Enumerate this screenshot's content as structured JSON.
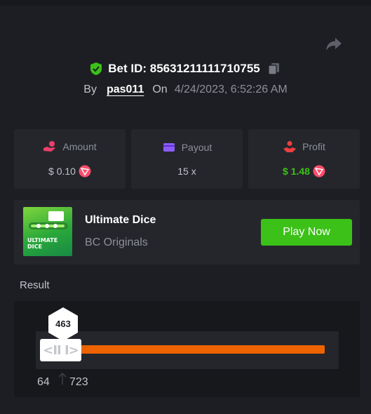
{
  "header": {
    "bet_id_label": "Bet ID: 85631211111710755",
    "by_label": "By",
    "username": "pas011",
    "on_label": "On",
    "date": "4/24/2023, 6:52:26 AM"
  },
  "stats": [
    {
      "label": "Amount",
      "value": "$ 0.10",
      "icon": "hand-coin-icon",
      "color": "#ed3f6a"
    },
    {
      "label": "Payout",
      "value": "15 x",
      "icon": "wallet-icon",
      "color": "#8b5cf6"
    },
    {
      "label": "Profit",
      "value": "$ 1.48",
      "icon": "profit-icon",
      "color": "#ed3f3f"
    }
  ],
  "game": {
    "thumb_text_1": "ULTIMATE",
    "thumb_text_2": "DICE",
    "title": "Ultimate Dice",
    "subtitle": "BC Originals",
    "play_label": "Play Now"
  },
  "result": {
    "label": "Result",
    "roll": "463",
    "range_min": "64",
    "range_max": "723",
    "handle_glyph": "<II I>"
  },
  "colors": {
    "accent_green": "#3bc117",
    "bar_orange": "#ed6300",
    "background": "#1d1e23"
  }
}
